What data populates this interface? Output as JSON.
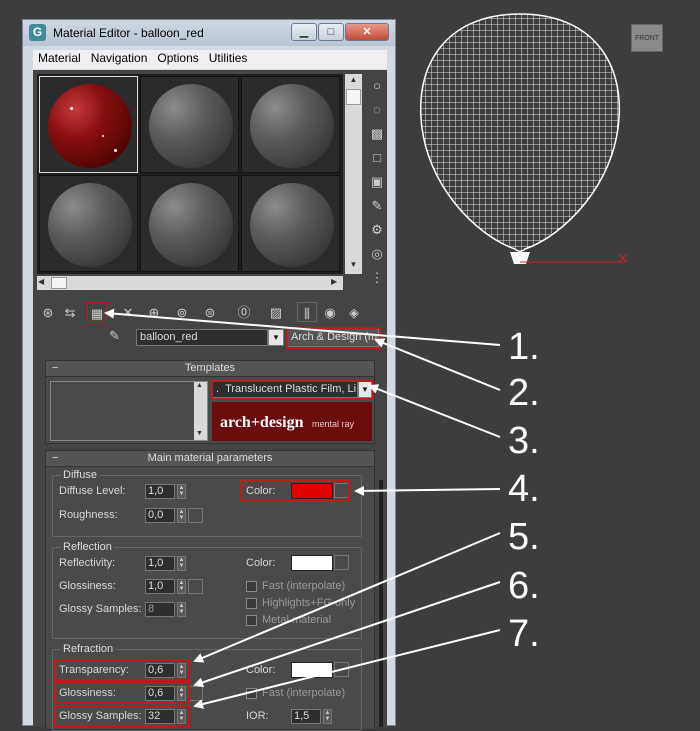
{
  "window": {
    "title": "Material Editor - balloon_red",
    "icon_letter": "G",
    "controls": {
      "minimize": "▁",
      "maximize": "□",
      "close": "✕"
    }
  },
  "menu": {
    "items": [
      "Material",
      "Navigation",
      "Options",
      "Utilities"
    ]
  },
  "material": {
    "name": "balloon_red",
    "type": "Arch & Design (mi)"
  },
  "templates": {
    "header": "Templates",
    "selected": "Translucent Plastic Film, Li",
    "banner_main": "arch+design",
    "banner_sub": "mental ray"
  },
  "params": {
    "header": "Main material parameters",
    "diffuse": {
      "title": "Diffuse",
      "level_label": "Diffuse Level:",
      "level": "1,0",
      "roughness_label": "Roughness:",
      "roughness": "0,0",
      "color_label": "Color:",
      "color": "#e00000"
    },
    "reflection": {
      "title": "Reflection",
      "reflectivity_label": "Reflectivity:",
      "reflectivity": "1,0",
      "glossiness_label": "Glossiness:",
      "glossiness": "1,0",
      "samples_label": "Glossy Samples:",
      "samples": "8",
      "color_label": "Color:",
      "color": "#ffffff",
      "fast_label": "Fast (interpolate)",
      "highlights_label": "Highlights+FG only",
      "metal_label": "Metal material"
    },
    "refraction": {
      "title": "Refraction",
      "transparency_label": "Transparency:",
      "transparency": "0,6",
      "glossiness_label": "Glossiness:",
      "glossiness": "0,6",
      "samples_label": "Glossy Samples:",
      "samples": "32",
      "color_label": "Color:",
      "color": "#ffffff",
      "fast_label": "Fast (interpolate)",
      "ior_label": "IOR:",
      "ior": "1,5"
    }
  },
  "viewport": {
    "viewcube_label": "FRONT"
  },
  "callouts": [
    "1.",
    "2.",
    "3.",
    "4.",
    "5.",
    "6.",
    "7."
  ],
  "colors": {
    "highlight_box": "#c11a1a",
    "balloon_wire": "#ffffff",
    "axis": "#cc2222"
  }
}
